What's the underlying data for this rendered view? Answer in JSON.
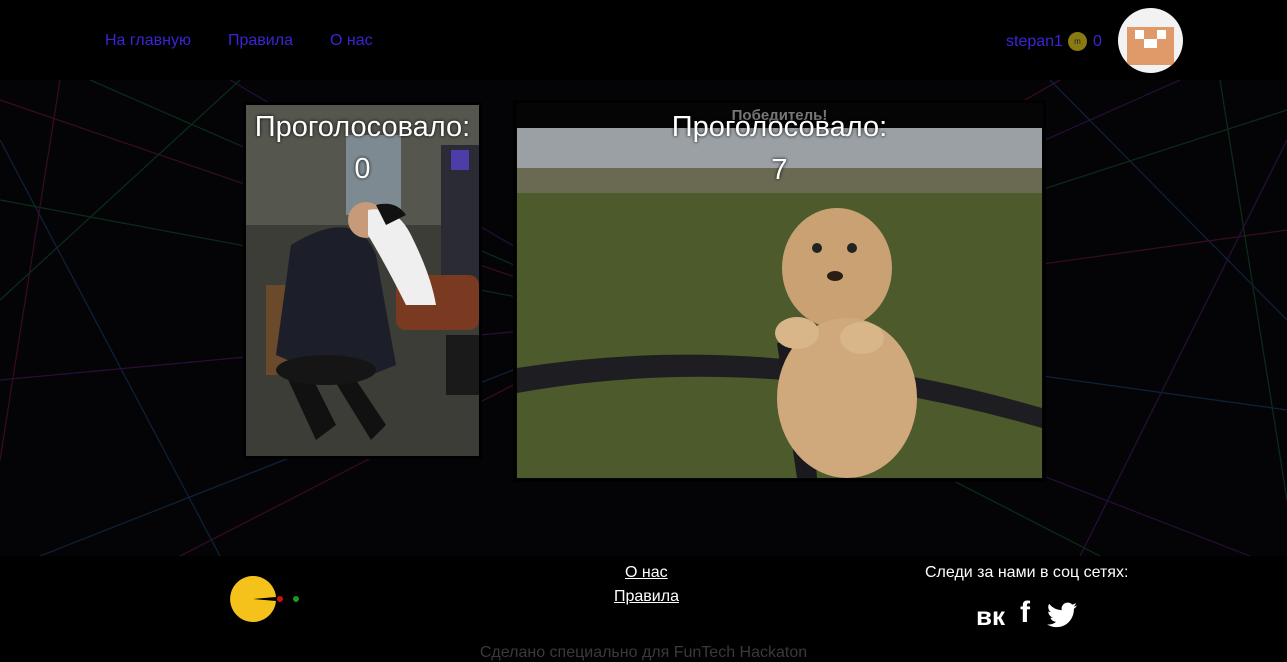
{
  "header": {
    "nav": [
      "На главную",
      "Правила",
      "О нас"
    ],
    "username": "stepan1",
    "coin_glyph": "m",
    "balance": "0",
    "avatar": "pixel-avatar"
  },
  "battle": {
    "winner_label": "Победитель!",
    "left": {
      "title": "Проголосовало:",
      "votes": "0",
      "image": "police-officer-with-cat"
    },
    "right": {
      "title": "Проголосовало:",
      "votes": "7",
      "image": "cheetah-on-fence"
    }
  },
  "footer": {
    "about": "О нас",
    "rules": "Правила",
    "follow": "Следи за нами в соц сетях:",
    "vk": "вк",
    "fb": "f",
    "credit": "Сделано специально для FunTech Hackaton"
  },
  "colors": {
    "nav": "#3a24d6",
    "background": "#000000",
    "coin": "#8a7a12",
    "pacman": "#f5c21b"
  }
}
